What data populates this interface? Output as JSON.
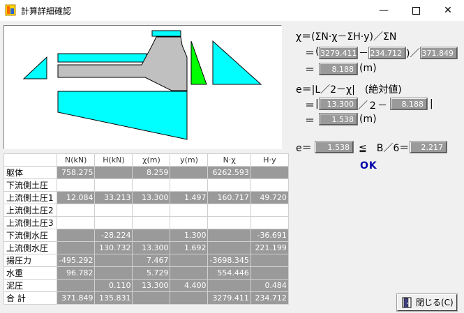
{
  "window": {
    "title": "計算詳細確認",
    "min_symbol": "—",
    "close_symbol": "✕"
  },
  "table": {
    "columns": [
      "N(kN)",
      "H(kN)",
      "χ(m)",
      "y(m)",
      "N·χ",
      "H·y"
    ],
    "rows": [
      {
        "label": "躯体",
        "cells": [
          "758.275",
          "",
          "8.259",
          "",
          "6262.593",
          ""
        ]
      },
      {
        "label": "下流側土圧",
        "cells": [
          "",
          "",
          "",
          "",
          "",
          ""
        ]
      },
      {
        "label": "上流側土圧1",
        "cells": [
          "12.084",
          "33.213",
          "13.300",
          "1.497",
          "160.717",
          "49.720"
        ]
      },
      {
        "label": "上流側土圧2",
        "cells": [
          "",
          "",
          "",
          "",
          "",
          ""
        ]
      },
      {
        "label": "上流側土圧3",
        "cells": [
          "",
          "",
          "",
          "",
          "",
          ""
        ]
      },
      {
        "label": "下流側水圧",
        "cells": [
          "",
          "-28.224",
          "",
          "1.300",
          "",
          "-36.691"
        ]
      },
      {
        "label": "上流側水圧",
        "cells": [
          "",
          "130.732",
          "13.300",
          "1.692",
          "",
          "221.199"
        ]
      },
      {
        "label": "揚圧力",
        "cells": [
          "-495.292",
          "",
          "7.467",
          "",
          "-3698.345",
          ""
        ]
      },
      {
        "label": "水重",
        "cells": [
          "96.782",
          "",
          "5.729",
          "",
          "554.446",
          ""
        ]
      },
      {
        "label": "泥圧",
        "cells": [
          "",
          "0.110",
          "13.300",
          "4.400",
          "",
          "0.484"
        ]
      },
      {
        "label": "合 計",
        "cells": [
          "371.849",
          "135.831",
          "",
          "",
          "3279.411",
          "234.712"
        ]
      }
    ]
  },
  "formula": {
    "chi_def": "χ＝(ΣN·χ－ΣH·y)／ΣN",
    "eq": "＝",
    "paren_open": "(",
    "minus": "－",
    "paren_close_div": ")／",
    "sum_nx": "3279.411",
    "sum_hy": "234.712",
    "sum_n": "371.849",
    "chi_result": "8.188",
    "unit_m": "(m)",
    "e_def": "e＝|L／2－χ|　(絶対値)",
    "bar_open": "|",
    "div2_minus": "／２－",
    "bar_close": "|",
    "L": "13.300",
    "chi": "8.188",
    "e_result": "1.538",
    "check_e": "e＝",
    "check_leq": "≦　B／6＝",
    "e_value": "1.538",
    "b6_value": "2.217",
    "status": "OK"
  },
  "buttons": {
    "close_label": "閉じる(C)"
  },
  "colors": {
    "structure": "#c0c0c0",
    "earth_pressure": "#00ffff",
    "water_pressure": "#00ff00",
    "value_box": "#9a9a9a",
    "ok_text": "#0000aa"
  }
}
